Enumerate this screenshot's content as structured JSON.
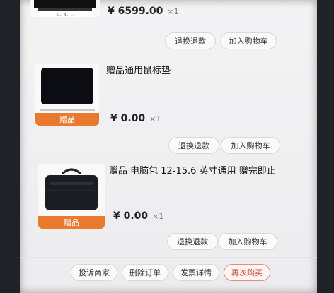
{
  "items": [
    {
      "title": "",
      "price": "¥ 6599.00",
      "qty": "×1",
      "buttons": [
        "退换退款",
        "加入购物车"
      ],
      "thumb_caption": "Z... N... ..."
    },
    {
      "title": "赠品通用鼠标垫",
      "price": "¥ 0.00",
      "qty": "×1",
      "badge": "赠品",
      "buttons": [
        "退换退款",
        "加入购物车"
      ]
    },
    {
      "title": "赠品 电脑包 12-15.6 英寸通用 赠完即止",
      "price": "¥ 0.00",
      "qty": "×1",
      "badge": "赠品",
      "buttons": [
        "退换退款",
        "加入购物车"
      ]
    }
  ],
  "order_actions": [
    "投诉商家",
    "删除订单",
    "发票详情",
    "再次购买"
  ],
  "colors": {
    "badge": "#e8792d",
    "accent_red": "#d24b3c"
  }
}
